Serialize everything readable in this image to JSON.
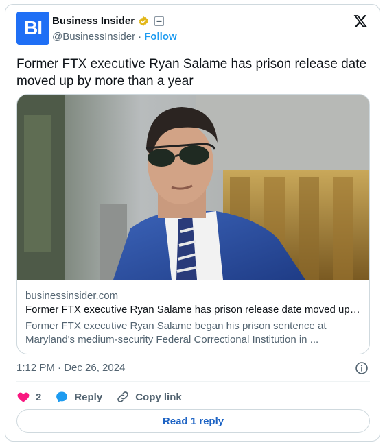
{
  "author": {
    "avatar_text": "BI",
    "display_name": "Business Insider",
    "handle": "@BusinessInsider",
    "separator": "·",
    "follow_label": "Follow"
  },
  "tweet": {
    "text": "Former FTX executive Ryan Salame has prison release date moved up by more than a year"
  },
  "link_card": {
    "domain": "businessinsider.com",
    "title": "Former FTX executive Ryan Salame has prison release date moved up by...",
    "description": "Former FTX executive Ryan Salame began his prison sentence at Maryland's medium-security Federal Correctional Institution in ..."
  },
  "meta": {
    "timestamp": "1:12 PM · Dec 26, 2024"
  },
  "actions": {
    "like_count": "2",
    "reply_label": "Reply",
    "copy_link_label": "Copy link",
    "read_reply_label": "Read 1 reply"
  },
  "colors": {
    "accent": "#1d9bf0",
    "like": "#f91880",
    "verified_gold": "#e2b719",
    "brand_blue": "#1f6ff5"
  }
}
